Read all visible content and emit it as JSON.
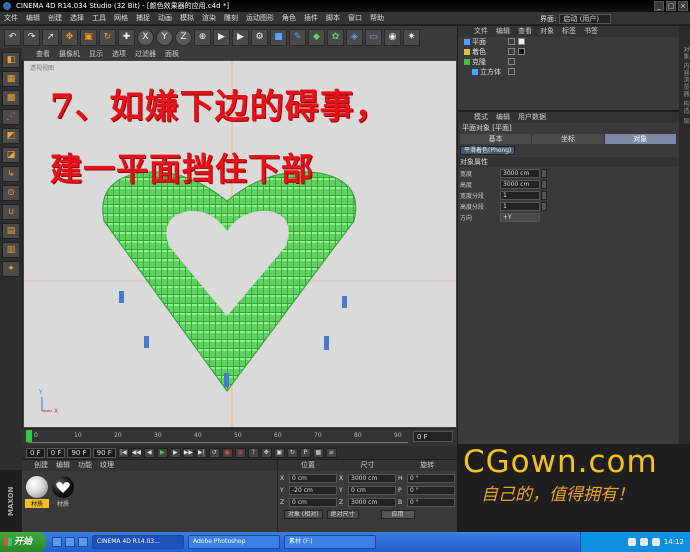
{
  "window": {
    "title": "CINEMA 4D R14.034 Studio (32 Bit) - [颜色效果器的应用.c4d *]",
    "layout_label": "界面:",
    "layout_value": "启动 (用户)"
  },
  "menu": [
    "文件",
    "编辑",
    "创建",
    "选择",
    "工具",
    "网格",
    "捕捉",
    "动画",
    "模拟",
    "渲染",
    "雕刻",
    "运动图形",
    "角色",
    "插件",
    "脚本",
    "窗口",
    "帮助"
  ],
  "toolbar": {
    "icons": [
      "undo",
      "redo",
      "live-select",
      "move",
      "scale",
      "rotate",
      "x-axis",
      "y-axis",
      "z-axis",
      "world-coord",
      "render-view",
      "render-picture",
      "render-settings",
      "cube",
      "pen",
      "subdivide",
      "array",
      "deformer",
      "floor",
      "camera",
      "light"
    ]
  },
  "viewport": {
    "menu": [
      "查看",
      "摄像机",
      "显示",
      "选项",
      "过滤器",
      "面板"
    ],
    "label": "透视视图",
    "caption_line1": "7、如嫌下边的碍事，",
    "caption_line2": "建一平面挡住下部",
    "axis_x": "X",
    "axis_y": "Y"
  },
  "timeline": {
    "ticks": [
      "0",
      "10",
      "20",
      "30",
      "40",
      "50",
      "60",
      "70",
      "80",
      "90"
    ],
    "current_frame": "0 F"
  },
  "transport": {
    "start": "0 F",
    "start2": "0 F",
    "end": "90 F",
    "end2": "90 F"
  },
  "material_panel": {
    "menu": [
      "创建",
      "编辑",
      "功能",
      "纹理"
    ],
    "materials": [
      {
        "name": "材质",
        "color": "#d8d8d8"
      },
      {
        "name": "材质",
        "color": "#111111"
      }
    ]
  },
  "maxon_label": "MAXON CINEMA 4D",
  "coordinates": {
    "headers": [
      "位置",
      "尺寸",
      "旋转"
    ],
    "rows": [
      {
        "axis": "X",
        "pos": "0 cm",
        "size_axis": "X",
        "size": "3000 cm",
        "rot_axis": "H",
        "rot": "0 °"
      },
      {
        "axis": "Y",
        "pos": "-20 cm",
        "size_axis": "Y",
        "size": "0 cm",
        "rot_axis": "P",
        "rot": "0 °"
      },
      {
        "axis": "Z",
        "pos": "0 cm",
        "size_axis": "Z",
        "size": "3000 cm",
        "rot_axis": "B",
        "rot": "0 °"
      }
    ],
    "mode": "对象 (相对)",
    "size_mode": "绝对尺寸",
    "apply": "应用"
  },
  "object_manager": {
    "menu": [
      "文件",
      "编辑",
      "查看",
      "对象",
      "标签",
      "书签"
    ],
    "items": [
      {
        "name": "平面",
        "color": "#4aa3ff"
      },
      {
        "name": "着色",
        "color": "#e0c040"
      },
      {
        "name": "克隆",
        "color": "#40c040"
      },
      {
        "name": "立方体",
        "color": "#4aa3ff"
      }
    ]
  },
  "side_tab": "对象 内容浏览器 构造 层",
  "attributes": {
    "menu": [
      "模式",
      "编辑",
      "用户数据"
    ],
    "title": "平面对象 [平面]",
    "tabs": [
      "基本",
      "坐标",
      "对象"
    ],
    "active_tab": "对象",
    "sub_tab": "平滑着色(Phong)",
    "section": "对象属性",
    "fields": [
      {
        "label": "宽度",
        "value": "3000 cm"
      },
      {
        "label": "高度",
        "value": "3000 cm"
      },
      {
        "label": "宽度分段",
        "value": "1"
      },
      {
        "label": "高度分段",
        "value": "1"
      },
      {
        "label": "方向",
        "value": "+Y"
      }
    ]
  },
  "brand": {
    "logo": "CGown.com",
    "slogan": "自己的，值得拥有！"
  },
  "taskbar": {
    "start": "开始",
    "tasks": [
      "CINEMA 4D R14.03...",
      "Adobe Photoshop",
      "素材 (F:)"
    ],
    "time": "14:12"
  }
}
